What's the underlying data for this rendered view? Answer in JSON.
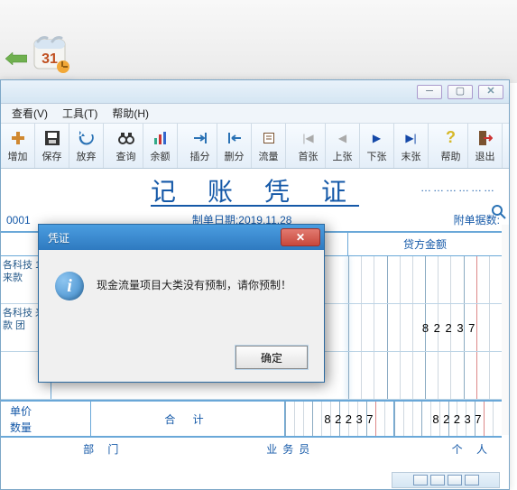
{
  "menu": {
    "view": "查看(V)",
    "tools": "工具(T)",
    "help": "帮助(H)"
  },
  "toolbar": {
    "add": "增加",
    "save": "保存",
    "discard": "放弃",
    "query": "查询",
    "balance": "余额",
    "insert": "插分",
    "delete": "删分",
    "flow": "流量",
    "first": "首张",
    "prev": "上张",
    "next": "下张",
    "last": "末张",
    "helpbtn": "帮助",
    "exit": "退出"
  },
  "doc": {
    "title": "记 账 凭 证",
    "seq": "0001",
    "date_label": "制单日期:",
    "date_value": "2019.11.28",
    "attach_label": "附单据数:",
    "credit_header": "贷方金额",
    "rows": [
      {
        "left": "各科技 1\n来款",
        "amount": ""
      },
      {
        "left": "各科技\n来款 团",
        "amount": "82237"
      },
      {
        "left": "",
        "amount": ""
      }
    ],
    "unit_price": "单价",
    "qty": "数量",
    "total_label": "合 计",
    "total_debit": "82237",
    "total_credit": "82237",
    "dept": "部 门",
    "clerk": "业务员",
    "person": "个 人"
  },
  "dialog": {
    "title": "凭证",
    "message": "现金流量项目大类没有预制，请你预制！",
    "ok": "确定"
  },
  "calendar_day": "31"
}
